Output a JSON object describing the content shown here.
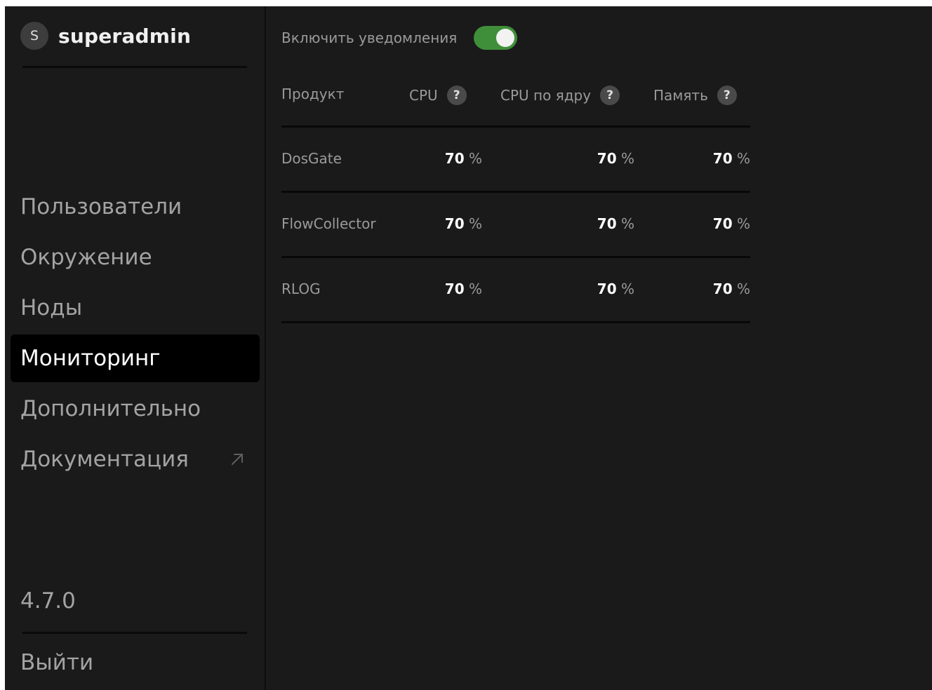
{
  "sidebar": {
    "user": {
      "avatar_letter": "S",
      "name": "superadmin"
    },
    "nav": [
      {
        "label": "Пользователи",
        "active": false
      },
      {
        "label": "Окружение",
        "active": false
      },
      {
        "label": "Ноды",
        "active": false
      },
      {
        "label": "Мониторинг",
        "active": true
      },
      {
        "label": "Дополнительно",
        "active": false
      },
      {
        "label": "Документация",
        "active": false,
        "icon": "external-link-arrow-icon"
      }
    ],
    "version": "4.7.0",
    "logout_label": "Выйти"
  },
  "main": {
    "notifications": {
      "label": "Включить уведомления",
      "enabled": true
    },
    "table": {
      "columns": [
        {
          "label": "Продукт",
          "help": false
        },
        {
          "label": "CPU",
          "help": true
        },
        {
          "label": "CPU по ядру",
          "help": true
        },
        {
          "label": "Память",
          "help": true
        }
      ],
      "help_glyph": "?",
      "rows": [
        {
          "product": "DosGate",
          "cpu": "70",
          "cpu_core": "70",
          "memory": "70",
          "unit": "%"
        },
        {
          "product": "FlowCollector",
          "cpu": "70",
          "cpu_core": "70",
          "memory": "70",
          "unit": "%"
        },
        {
          "product": "RLOG",
          "cpu": "70",
          "cpu_core": "70",
          "memory": "70",
          "unit": "%"
        }
      ]
    }
  },
  "colors": {
    "background": "#1a1a1a",
    "active_nav": "#000000",
    "toggle_on": "#3f8f3a",
    "text_muted": "#9a9a9a",
    "text_bright": "#ffffff"
  }
}
